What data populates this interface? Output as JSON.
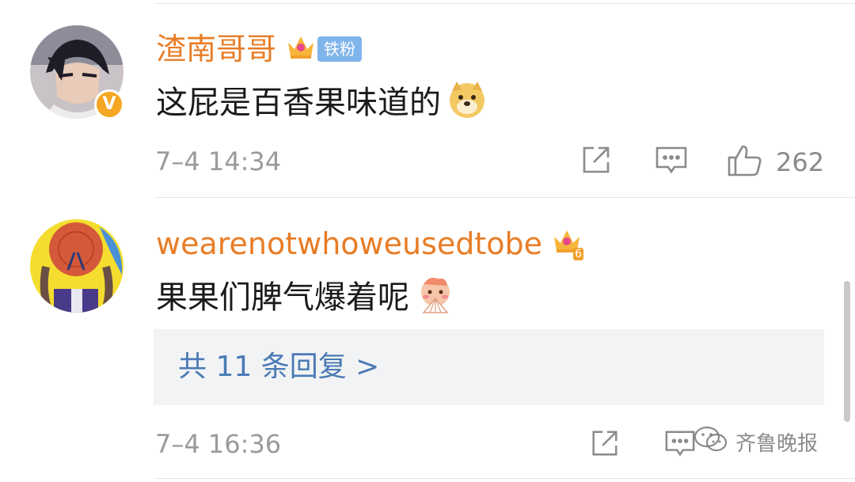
{
  "colors": {
    "username": "#e87d26",
    "reply_link": "#4b7bb5",
    "timestamp": "#9a9a9a",
    "fan_badge_bg": "#7fb5ea",
    "verified_badge": "#f5a623"
  },
  "comments": [
    {
      "username": "渣南哥哥",
      "fan_badge": "铁粉",
      "verified_icon_text": "V",
      "text": "这屁是百香果味道的",
      "emoji_icon": "doge-emoji-icon",
      "timestamp": "7–4 14:34",
      "like_count": "262"
    },
    {
      "username": "wearenotwhoweusedtobe",
      "crown_level": "6",
      "text": "果果们脾气爆着呢",
      "emoji_icon": "shy-fan-emoji-icon",
      "replies_label": "共 11 条回复 >",
      "timestamp": "7–4 16:36"
    }
  ],
  "watermark": {
    "text": "齐鲁晚报",
    "icon": "wechat-icon"
  }
}
